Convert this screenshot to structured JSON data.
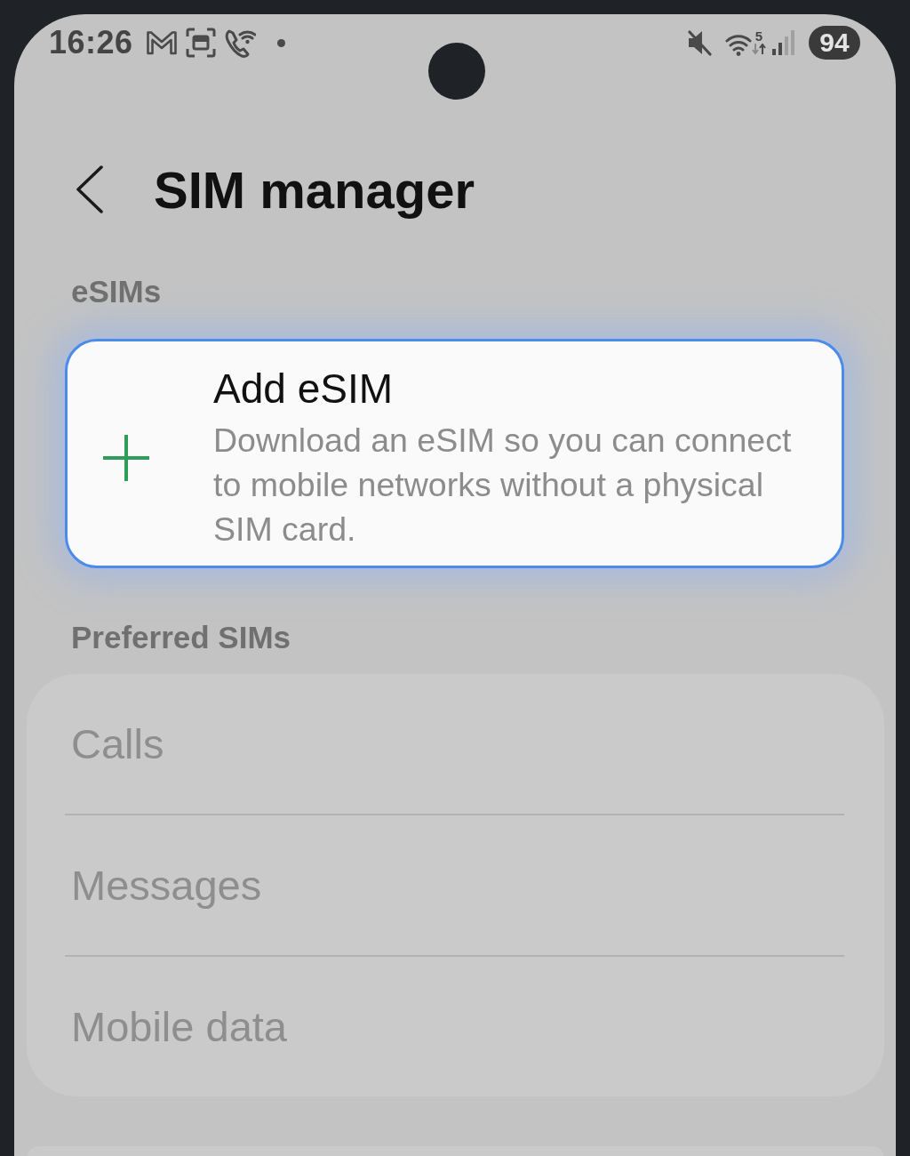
{
  "status_bar": {
    "time": "16:26",
    "wifi_band": "5",
    "battery": "94"
  },
  "header": {
    "title": "SIM manager"
  },
  "esims": {
    "label": "eSIMs",
    "add_card": {
      "title": "Add eSIM",
      "description": "Download an eSIM so you can connect to mobile networks without a physical SIM card.",
      "highlighted": true
    }
  },
  "preferred": {
    "label": "Preferred SIMs",
    "items": [
      {
        "label": "Calls",
        "disabled": true
      },
      {
        "label": "Messages",
        "disabled": true
      },
      {
        "label": "Mobile data",
        "disabled": true
      }
    ]
  }
}
